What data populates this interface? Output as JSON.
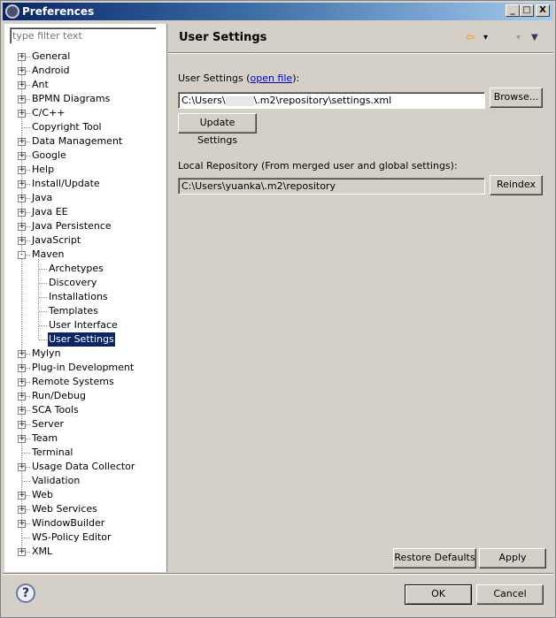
{
  "window": {
    "title": "Preferences",
    "minimize": "_",
    "maximize": "□",
    "close": "X"
  },
  "filter": {
    "placeholder": "type filter text"
  },
  "tree": [
    {
      "label": "General",
      "exp": "+"
    },
    {
      "label": "Android",
      "exp": "+"
    },
    {
      "label": "Ant",
      "exp": "+"
    },
    {
      "label": "BPMN Diagrams",
      "exp": "+"
    },
    {
      "label": "C/C++",
      "exp": "+"
    },
    {
      "label": "Copyright Tool",
      "exp": ""
    },
    {
      "label": "Data Management",
      "exp": "+"
    },
    {
      "label": "Google",
      "exp": "+"
    },
    {
      "label": "Help",
      "exp": "+"
    },
    {
      "label": "Install/Update",
      "exp": "+"
    },
    {
      "label": "Java",
      "exp": "+"
    },
    {
      "label": "Java EE",
      "exp": "+"
    },
    {
      "label": "Java Persistence",
      "exp": "+"
    },
    {
      "label": "JavaScript",
      "exp": "+"
    },
    {
      "label": "Maven",
      "exp": "-",
      "children": [
        {
          "label": "Archetypes"
        },
        {
          "label": "Discovery"
        },
        {
          "label": "Installations"
        },
        {
          "label": "Templates"
        },
        {
          "label": "User Interface"
        },
        {
          "label": "User Settings",
          "selected": true
        }
      ]
    },
    {
      "label": "Mylyn",
      "exp": "+"
    },
    {
      "label": "Plug-in Development",
      "exp": "+"
    },
    {
      "label": "Remote Systems",
      "exp": "+"
    },
    {
      "label": "Run/Debug",
      "exp": "+"
    },
    {
      "label": "SCA Tools",
      "exp": "+"
    },
    {
      "label": "Server",
      "exp": "+"
    },
    {
      "label": "Team",
      "exp": "+"
    },
    {
      "label": "Terminal",
      "exp": ""
    },
    {
      "label": "Usage Data Collector",
      "exp": "+"
    },
    {
      "label": "Validation",
      "exp": ""
    },
    {
      "label": "Web",
      "exp": "+"
    },
    {
      "label": "Web Services",
      "exp": "+"
    },
    {
      "label": "WindowBuilder",
      "exp": "+"
    },
    {
      "label": "WS-Policy Editor",
      "exp": ""
    },
    {
      "label": "XML",
      "exp": "+"
    }
  ],
  "page": {
    "title": "User Settings",
    "back": "⇦",
    "forward": "⇨",
    "dropdown": "▾",
    "menu": "▼",
    "user_settings_label_pre": "User Settings (",
    "open_file": "open file",
    "user_settings_label_post": "):",
    "settings_path_pre": "C:\\Users\\",
    "settings_path_post": "\\.m2\\repository\\settings.xml",
    "browse": "Browse...",
    "update_settings": "Update Settings",
    "local_repo_label": "Local Repository (From merged user and global settings):",
    "local_repo_path": "C:\\Users\\yuanka\\.m2\\repository",
    "reindex": "Reindex",
    "restore_defaults": "Restore Defaults",
    "apply": "Apply"
  },
  "footer": {
    "help": "?",
    "ok": "OK",
    "cancel": "Cancel"
  }
}
